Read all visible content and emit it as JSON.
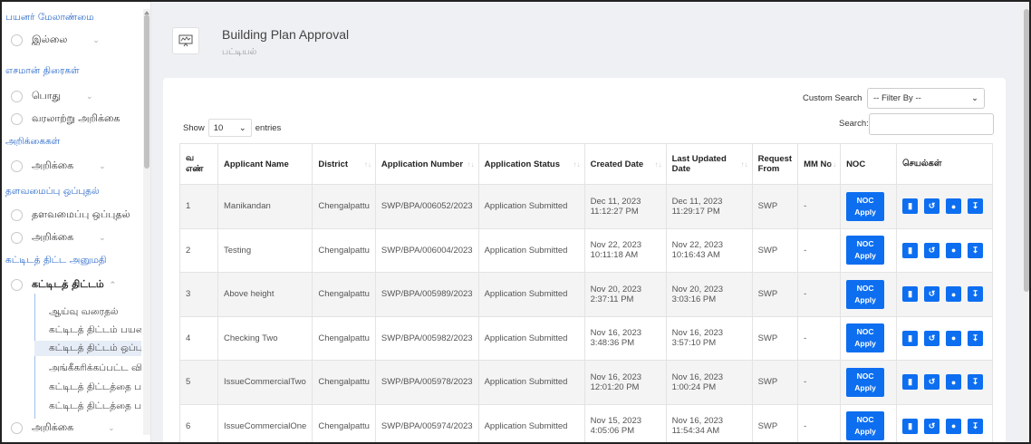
{
  "sidebar": {
    "sections": [
      {
        "label": "பயனர் மேலாண்மை",
        "items": [
          {
            "label": "இல்லை"
          }
        ]
      },
      {
        "label": "எசமான் திரைகள்",
        "items": [
          {
            "label": "பொது"
          },
          {
            "label": "வரலாற்று அறிக்கை"
          }
        ]
      },
      {
        "label": "அறிக்கைகள்",
        "items": [
          {
            "label": "அறிக்கை"
          }
        ]
      },
      {
        "label": "தளவமைப்பு ஒப்புதல்",
        "items": [
          {
            "label": "தளவமைப்பு ஒப்புதல்"
          },
          {
            "label": "அறிக்கை"
          }
        ]
      },
      {
        "label": "கட்டிடத் திட்ட அனுமதி",
        "items": [
          {
            "label": "கட்டிடத் திட்டம்"
          }
        ]
      }
    ],
    "submenu": [
      "ஆய்வு வரைதல்",
      "கட்டிடத் திட்டம் பயன",
      "கட்டிடத் திட்டம் ஒப்பு",
      "அங்கீகரிக்கப்பட்ட வி",
      "கட்டிடத் திட்டத்தை ப",
      "கட்டிடத் திட்டத்தை ப"
    ],
    "last_item": "அறிக்கை"
  },
  "header": {
    "title": "Building Plan Approval",
    "subtitle": "பட்டியல்",
    "icon": "plan-icon"
  },
  "controls": {
    "custom_search_label": "Custom Search",
    "filter_placeholder": "-- Filter By --",
    "search_label": "Search:",
    "show_label": "Show",
    "entries_value": "10",
    "entries_label": "entries"
  },
  "table": {
    "headers": [
      "வ எண்",
      "Applicant Name",
      "District",
      "Application Number",
      "Application Status",
      "Created Date",
      "Last Updated Date",
      "Request From",
      "MM No",
      "NOC",
      "செயல்கள்"
    ],
    "noc_label_1": "NOC",
    "noc_label_2": "Apply",
    "rows": [
      {
        "no": "1",
        "name": "Manikandan",
        "district": "Chengalpattu",
        "app_no": "SWP/BPA/006052/2023",
        "status": "Application Submitted",
        "created_d": "Dec 11, 2023",
        "created_t": "11:12:27 PM",
        "updated_d": "Dec 11, 2023",
        "updated_t": "11:29:17 PM",
        "from": "SWP",
        "mm": "-"
      },
      {
        "no": "2",
        "name": "Testing",
        "district": "Chengalpattu",
        "app_no": "SWP/BPA/006004/2023",
        "status": "Application Submitted",
        "created_d": "Nov 22, 2023",
        "created_t": "10:11:18 AM",
        "updated_d": "Nov 22, 2023",
        "updated_t": "10:16:43 AM",
        "from": "SWP",
        "mm": "-"
      },
      {
        "no": "3",
        "name": "Above height",
        "district": "Chengalpattu",
        "app_no": "SWP/BPA/005989/2023",
        "status": "Application Submitted",
        "created_d": "Nov 20, 2023",
        "created_t": "2:37:11 PM",
        "updated_d": "Nov 20, 2023",
        "updated_t": "3:03:16 PM",
        "from": "SWP",
        "mm": "-"
      },
      {
        "no": "4",
        "name": "Checking Two",
        "district": "Chengalpattu",
        "app_no": "SWP/BPA/005982/2023",
        "status": "Application Submitted",
        "created_d": "Nov 16, 2023",
        "created_t": "3:48:36 PM",
        "updated_d": "Nov 16, 2023",
        "updated_t": "3:57:10 PM",
        "from": "SWP",
        "mm": "-"
      },
      {
        "no": "5",
        "name": "IssueCommercialTwo",
        "district": "Chengalpattu",
        "app_no": "SWP/BPA/005978/2023",
        "status": "Application Submitted",
        "created_d": "Nov 16, 2023",
        "created_t": "12:01:20 PM",
        "updated_d": "Nov 16, 2023",
        "updated_t": "1:00:24 PM",
        "from": "SWP",
        "mm": "-"
      },
      {
        "no": "6",
        "name": "IssueCommercialOne",
        "district": "Chengalpattu",
        "app_no": "SWP/BPA/005974/2023",
        "status": "Application Submitted",
        "created_d": "Nov 15, 2023",
        "created_t": "4:05:06 PM",
        "updated_d": "Nov 16, 2023",
        "updated_t": "11:54:34 AM",
        "from": "SWP",
        "mm": "-"
      }
    ]
  },
  "colors": {
    "primary": "#0d6ef0",
    "section": "#2a6acb"
  }
}
